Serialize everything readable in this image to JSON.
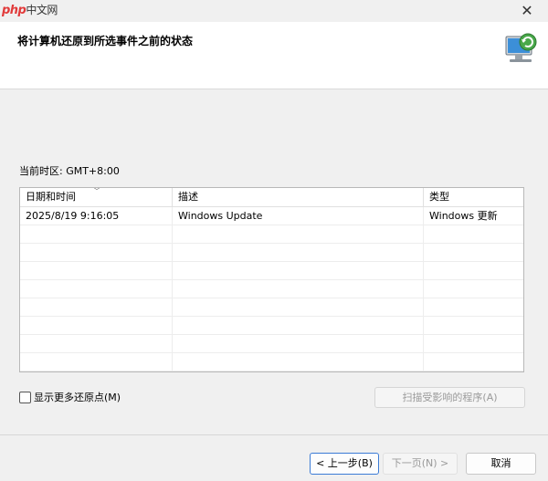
{
  "watermark": {
    "php": "php",
    "cn": "中文网"
  },
  "window": {
    "close_glyph": "✕"
  },
  "header": {
    "title": "将计算机还原到所选事件之前的状态",
    "icon": "system-restore-icon"
  },
  "timezone_label": "当前时区: GMT+8:00",
  "table": {
    "columns": [
      "日期和时间",
      "描述",
      "类型"
    ],
    "rows": [
      [
        "2025/8/19 9:16:05",
        "Windows Update",
        "Windows 更新"
      ]
    ]
  },
  "options": {
    "show_more_label": "显示更多还原点(M)",
    "show_more_checked": false,
    "scan_button_label": "扫描受影响的程序(A)"
  },
  "footer": {
    "back_label": "< 上一步(B)",
    "next_label": "下一页(N) >",
    "cancel_label": "取消"
  },
  "colors": {
    "accent": "#3b7bd6",
    "disabled_text": "#9a9a9a"
  }
}
